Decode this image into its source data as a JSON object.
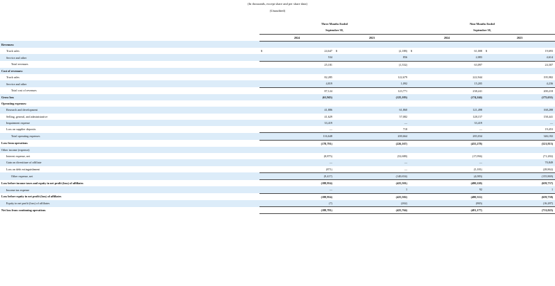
{
  "header": {
    "line1": "(In thousands, except share and per share data)",
    "line2": "(Unaudited)"
  },
  "columns": {
    "group1": "Three Months Ended",
    "group1_sub": "September 30,",
    "group2": "Nine Months Ended",
    "group2_sub": "September 30,",
    "years": [
      "2024",
      "2023",
      "2024",
      "2023"
    ]
  },
  "rows": [
    {
      "label": "Revenues:",
      "type": "section"
    },
    {
      "label": "Truck sales",
      "indent": 1,
      "cur": true,
      "v": [
        "24,647",
        "(2,188)",
        "61,008",
        "19,693"
      ]
    },
    {
      "label": "Service and other",
      "indent": 1,
      "v": [
        "534",
        "856",
        "2,083",
        "4,614"
      ],
      "rule": "single"
    },
    {
      "label": "Total revenues",
      "indent": 2,
      "v": [
        "25,181",
        "(1,332)",
        "63,097",
        "24,307"
      ]
    },
    {
      "label": "Cost of revenues:",
      "type": "section"
    },
    {
      "label": "Truck sales",
      "indent": 1,
      "v": [
        "82,285",
        "122,679",
        "222,944",
        "195,982"
      ]
    },
    {
      "label": "Service and other",
      "indent": 1,
      "v": [
        "4,819",
        "1,092",
        "15,205",
        "4,236"
      ],
      "rule": "single"
    },
    {
      "label": "Total cost of revenues",
      "indent": 2,
      "v": [
        "87,124",
        "123,771",
        "238,241",
        "200,218"
      ]
    },
    {
      "label": "Gross loss",
      "type": "bold",
      "v": [
        "(61,943)",
        "(125,103)",
        "(174,244)",
        "(175,631)"
      ]
    },
    {
      "label": "Operating expenses:",
      "type": "section"
    },
    {
      "label": "Research and development",
      "indent": 1,
      "v": [
        "41,886",
        "61,860",
        "121,498",
        "168,288"
      ]
    },
    {
      "label": "Selling, general, and administrative",
      "indent": 1,
      "v": [
        "41,629",
        "57,082",
        "128,157",
        "158,441"
      ]
    },
    {
      "label": "Impairment expense",
      "indent": 1,
      "v": [
        "33,419",
        "—",
        "33,419",
        "—"
      ]
    },
    {
      "label": "Loss on supplier deposits",
      "indent": 1,
      "v": [
        "—",
        "718",
        "—",
        "19,453"
      ],
      "rule": "single"
    },
    {
      "label": "Total operating expenses",
      "indent": 2,
      "v": [
        "116,648",
        "200,664",
        "283,034",
        "346,182"
      ],
      "rule": "single"
    },
    {
      "label": "Loss from operations",
      "type": "bold",
      "v": [
        "(178,791)",
        "(226,167)",
        "(455,278)",
        "(521,813)"
      ]
    },
    {
      "label": "Other income (expense):",
      "indent": 0
    },
    {
      "label": "Interest expense, net",
      "indent": 1,
      "v": [
        "(8,875)",
        "(52,688)",
        "(17,094)",
        "(71,282)"
      ]
    },
    {
      "label": "Gain on divestiture of affiliate",
      "indent": 1,
      "v": [
        "—",
        "—",
        "—",
        "70,849"
      ]
    },
    {
      "label": "Loss on debt extinguishment",
      "indent": 1,
      "v": [
        "(871)",
        "—",
        "(5,181)",
        "(28,862)"
      ],
      "rule": "single"
    },
    {
      "label": "Other expense, net",
      "indent": 2,
      "v": [
        "(9,417)",
        "(140,654)",
        "(4,083)",
        "(155,869)"
      ],
      "rule": "single"
    },
    {
      "label": "Loss before income taxes and equity in net profit (loss) of affiliates",
      "type": "bold",
      "v": [
        "(188,954)",
        "(425,501)",
        "(480,220)",
        "(659,737)"
      ]
    },
    {
      "label": "Income tax expense",
      "indent": 1,
      "v": [
        "—",
        "1",
        "92",
        "1"
      ],
      "rule": "single"
    },
    {
      "label": "Loss before equity in net profit (loss) of affiliates",
      "type": "bold",
      "v": [
        "(188,954)",
        "(425,502)",
        "(480,312)",
        "(659,738)"
      ]
    },
    {
      "label": "Equity in net profit (loss) of affiliates",
      "indent": 1,
      "v": [
        "(7)",
        "(262)",
        "(865)",
        "(16,287)"
      ],
      "rule": "single"
    },
    {
      "label": "Net loss from continuing operations",
      "type": "bold",
      "v": [
        "(188,781)",
        "(425,764)",
        "(481,177)",
        "(711,025)"
      ],
      "rule": "double"
    }
  ]
}
